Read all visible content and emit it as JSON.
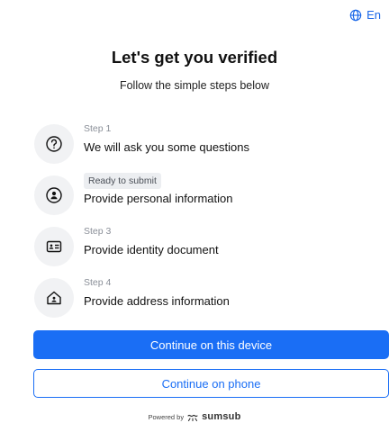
{
  "language": {
    "label": "En",
    "icon": "globe-icon",
    "color": "#1967e8"
  },
  "header": {
    "title": "Let's get you verified",
    "subtitle": "Follow the simple steps below"
  },
  "steps": [
    {
      "meta": "Step 1",
      "label": "We will ask you some questions",
      "icon": "question-icon",
      "badge": false
    },
    {
      "meta": "Ready to submit",
      "label": "Provide personal information",
      "icon": "person-icon",
      "badge": true
    },
    {
      "meta": "Step 3",
      "label": "Provide identity document",
      "icon": "id-card-icon",
      "badge": false
    },
    {
      "meta": "Step 4",
      "label": "Provide address information",
      "icon": "home-icon",
      "badge": false
    }
  ],
  "buttons": {
    "primary": "Continue on this device",
    "secondary": "Continue on phone",
    "accent": "#1a6ef5"
  },
  "footer": {
    "prefix": "Powered by",
    "brand": "sumsub",
    "icon": "sumsub-logo-icon"
  }
}
